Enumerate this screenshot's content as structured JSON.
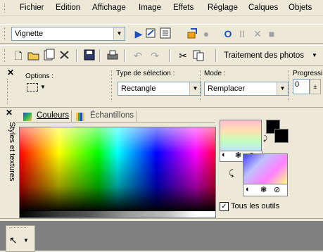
{
  "menu": {
    "items": [
      "Fichier",
      "Edition",
      "Affichage",
      "Image",
      "Effets",
      "Réglage",
      "Calques",
      "Objets"
    ]
  },
  "script_toolbar": {
    "selected_script": "Vignette"
  },
  "standard_toolbar": {
    "workspace_label": "Traitement des photos"
  },
  "tool_options": {
    "options_label": "Options :",
    "selection_type_label": "Type de sélection :",
    "selection_type_value": "Rectangle",
    "mode_label": "Mode :",
    "mode_value": "Remplacer",
    "progressive_label": "Progressi",
    "progressive_value": "0"
  },
  "palette": {
    "side_title": "Styles et textures",
    "tab_colors": "Couleurs",
    "tab_swatches": "Échantillons",
    "all_tools_label": "Tous les outils",
    "all_tools_checked": true,
    "foreground_color": "#000000",
    "background_color": "#000000"
  }
}
